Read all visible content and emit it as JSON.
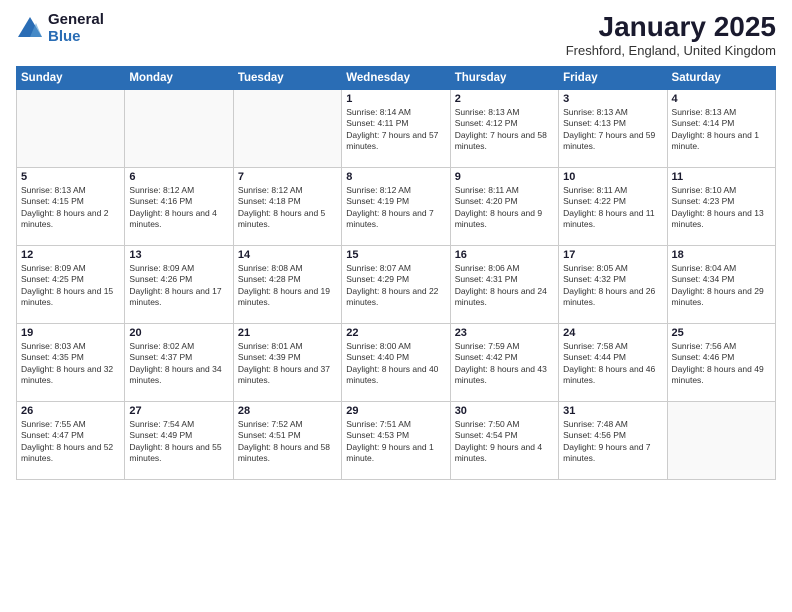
{
  "header": {
    "logo_general": "General",
    "logo_blue": "Blue",
    "title": "January 2025",
    "location": "Freshford, England, United Kingdom"
  },
  "days_of_week": [
    "Sunday",
    "Monday",
    "Tuesday",
    "Wednesday",
    "Thursday",
    "Friday",
    "Saturday"
  ],
  "weeks": [
    [
      {
        "day": "",
        "content": ""
      },
      {
        "day": "",
        "content": ""
      },
      {
        "day": "",
        "content": ""
      },
      {
        "day": "1",
        "content": "Sunrise: 8:14 AM\nSunset: 4:11 PM\nDaylight: 7 hours and 57 minutes."
      },
      {
        "day": "2",
        "content": "Sunrise: 8:13 AM\nSunset: 4:12 PM\nDaylight: 7 hours and 58 minutes."
      },
      {
        "day": "3",
        "content": "Sunrise: 8:13 AM\nSunset: 4:13 PM\nDaylight: 7 hours and 59 minutes."
      },
      {
        "day": "4",
        "content": "Sunrise: 8:13 AM\nSunset: 4:14 PM\nDaylight: 8 hours and 1 minute."
      }
    ],
    [
      {
        "day": "5",
        "content": "Sunrise: 8:13 AM\nSunset: 4:15 PM\nDaylight: 8 hours and 2 minutes."
      },
      {
        "day": "6",
        "content": "Sunrise: 8:12 AM\nSunset: 4:16 PM\nDaylight: 8 hours and 4 minutes."
      },
      {
        "day": "7",
        "content": "Sunrise: 8:12 AM\nSunset: 4:18 PM\nDaylight: 8 hours and 5 minutes."
      },
      {
        "day": "8",
        "content": "Sunrise: 8:12 AM\nSunset: 4:19 PM\nDaylight: 8 hours and 7 minutes."
      },
      {
        "day": "9",
        "content": "Sunrise: 8:11 AM\nSunset: 4:20 PM\nDaylight: 8 hours and 9 minutes."
      },
      {
        "day": "10",
        "content": "Sunrise: 8:11 AM\nSunset: 4:22 PM\nDaylight: 8 hours and 11 minutes."
      },
      {
        "day": "11",
        "content": "Sunrise: 8:10 AM\nSunset: 4:23 PM\nDaylight: 8 hours and 13 minutes."
      }
    ],
    [
      {
        "day": "12",
        "content": "Sunrise: 8:09 AM\nSunset: 4:25 PM\nDaylight: 8 hours and 15 minutes."
      },
      {
        "day": "13",
        "content": "Sunrise: 8:09 AM\nSunset: 4:26 PM\nDaylight: 8 hours and 17 minutes."
      },
      {
        "day": "14",
        "content": "Sunrise: 8:08 AM\nSunset: 4:28 PM\nDaylight: 8 hours and 19 minutes."
      },
      {
        "day": "15",
        "content": "Sunrise: 8:07 AM\nSunset: 4:29 PM\nDaylight: 8 hours and 22 minutes."
      },
      {
        "day": "16",
        "content": "Sunrise: 8:06 AM\nSunset: 4:31 PM\nDaylight: 8 hours and 24 minutes."
      },
      {
        "day": "17",
        "content": "Sunrise: 8:05 AM\nSunset: 4:32 PM\nDaylight: 8 hours and 26 minutes."
      },
      {
        "day": "18",
        "content": "Sunrise: 8:04 AM\nSunset: 4:34 PM\nDaylight: 8 hours and 29 minutes."
      }
    ],
    [
      {
        "day": "19",
        "content": "Sunrise: 8:03 AM\nSunset: 4:35 PM\nDaylight: 8 hours and 32 minutes."
      },
      {
        "day": "20",
        "content": "Sunrise: 8:02 AM\nSunset: 4:37 PM\nDaylight: 8 hours and 34 minutes."
      },
      {
        "day": "21",
        "content": "Sunrise: 8:01 AM\nSunset: 4:39 PM\nDaylight: 8 hours and 37 minutes."
      },
      {
        "day": "22",
        "content": "Sunrise: 8:00 AM\nSunset: 4:40 PM\nDaylight: 8 hours and 40 minutes."
      },
      {
        "day": "23",
        "content": "Sunrise: 7:59 AM\nSunset: 4:42 PM\nDaylight: 8 hours and 43 minutes."
      },
      {
        "day": "24",
        "content": "Sunrise: 7:58 AM\nSunset: 4:44 PM\nDaylight: 8 hours and 46 minutes."
      },
      {
        "day": "25",
        "content": "Sunrise: 7:56 AM\nSunset: 4:46 PM\nDaylight: 8 hours and 49 minutes."
      }
    ],
    [
      {
        "day": "26",
        "content": "Sunrise: 7:55 AM\nSunset: 4:47 PM\nDaylight: 8 hours and 52 minutes."
      },
      {
        "day": "27",
        "content": "Sunrise: 7:54 AM\nSunset: 4:49 PM\nDaylight: 8 hours and 55 minutes."
      },
      {
        "day": "28",
        "content": "Sunrise: 7:52 AM\nSunset: 4:51 PM\nDaylight: 8 hours and 58 minutes."
      },
      {
        "day": "29",
        "content": "Sunrise: 7:51 AM\nSunset: 4:53 PM\nDaylight: 9 hours and 1 minute."
      },
      {
        "day": "30",
        "content": "Sunrise: 7:50 AM\nSunset: 4:54 PM\nDaylight: 9 hours and 4 minutes."
      },
      {
        "day": "31",
        "content": "Sunrise: 7:48 AM\nSunset: 4:56 PM\nDaylight: 9 hours and 7 minutes."
      },
      {
        "day": "",
        "content": ""
      }
    ]
  ]
}
